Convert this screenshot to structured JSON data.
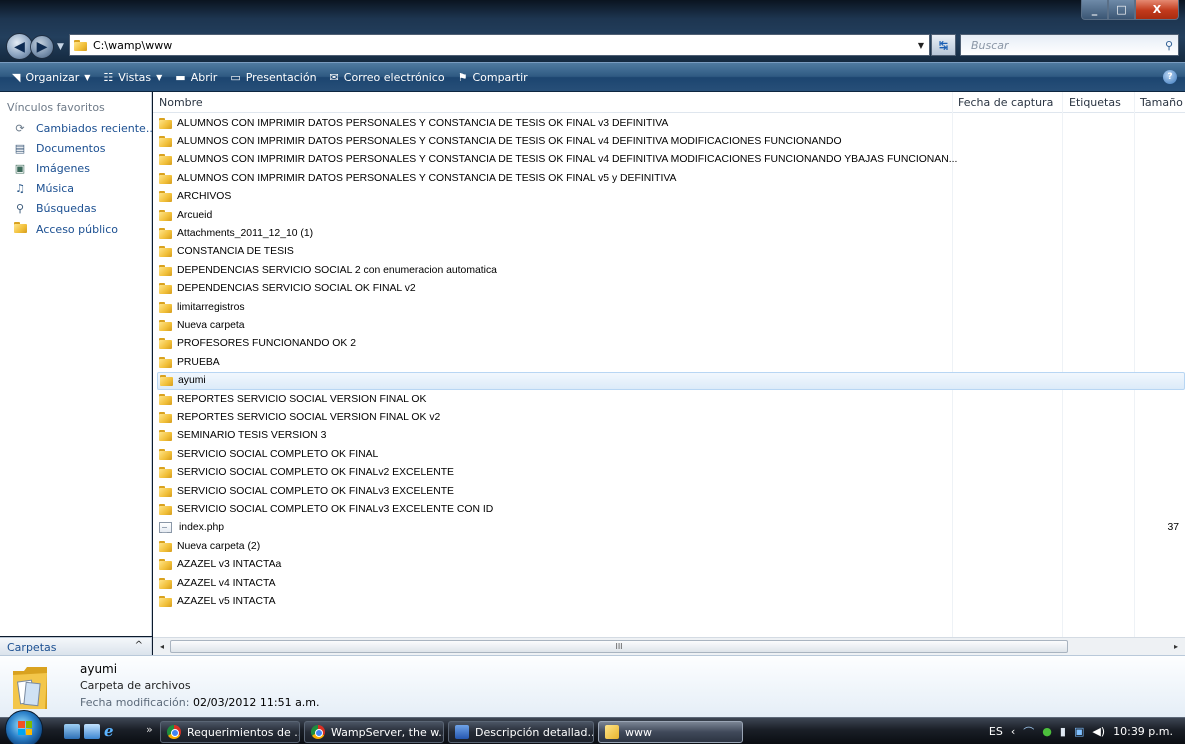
{
  "window": {
    "controls": {
      "minimize": "_",
      "maximize": "□",
      "close": "X"
    }
  },
  "address": {
    "path": "C:\\wamp\\www",
    "search_placeholder": "Buscar"
  },
  "commandbar": {
    "items": [
      {
        "label": "Organizar",
        "icon": "organize-icon",
        "dropdown": true
      },
      {
        "label": "Vistas",
        "icon": "views-icon",
        "dropdown": true
      },
      {
        "label": "Abrir",
        "icon": "open-icon",
        "dropdown": false
      },
      {
        "label": "Presentación",
        "icon": "slideshow-icon",
        "dropdown": false
      },
      {
        "label": "Correo electrónico",
        "icon": "email-icon",
        "dropdown": false
      },
      {
        "label": "Compartir",
        "icon": "share-icon",
        "dropdown": false
      }
    ],
    "help": "?"
  },
  "navpane": {
    "title": "Vínculos favoritos",
    "items": [
      {
        "label": "Cambiados reciente...",
        "icon": "recent-icon"
      },
      {
        "label": "Documentos",
        "icon": "documents-icon"
      },
      {
        "label": "Imágenes",
        "icon": "pictures-icon"
      },
      {
        "label": "Música",
        "icon": "music-icon"
      },
      {
        "label": "Búsquedas",
        "icon": "searches-icon"
      },
      {
        "label": "Acceso público",
        "icon": "public-folder-icon"
      }
    ],
    "folders_label": "Carpetas",
    "folders_chevron": "^"
  },
  "columns": {
    "name": "Nombre",
    "date": "Fecha de captura",
    "tags": "Etiquetas",
    "size": "Tamaño"
  },
  "files": [
    {
      "name": "ALUMNOS CON IMPRIMIR DATOS PERSONALES Y CONSTANCIA DE TESIS OK FINAL v3 DEFINITIVA",
      "type": "folder"
    },
    {
      "name": "ALUMNOS CON IMPRIMIR DATOS PERSONALES Y CONSTANCIA DE TESIS OK FINAL v4 DEFINITIVA MODIFICACIONES FUNCIONANDO",
      "type": "folder"
    },
    {
      "name": "ALUMNOS CON IMPRIMIR DATOS PERSONALES Y CONSTANCIA DE TESIS OK FINAL v4 DEFINITIVA MODIFICACIONES FUNCIONANDO YBAJAS FUNCIONAN...",
      "type": "folder"
    },
    {
      "name": "ALUMNOS CON IMPRIMIR DATOS PERSONALES Y CONSTANCIA DE TESIS OK FINAL v5 y DEFINITIVA",
      "type": "folder"
    },
    {
      "name": "ARCHIVOS",
      "type": "folder"
    },
    {
      "name": "Arcueid",
      "type": "folder"
    },
    {
      "name": "Attachments_2011_12_10 (1)",
      "type": "folder"
    },
    {
      "name": "CONSTANCIA DE TESIS",
      "type": "folder"
    },
    {
      "name": "DEPENDENCIAS SERVICIO SOCIAL 2 con enumeracion automatica",
      "type": "folder"
    },
    {
      "name": "DEPENDENCIAS SERVICIO SOCIAL OK FINAL v2",
      "type": "folder"
    },
    {
      "name": "limitarregistros",
      "type": "folder"
    },
    {
      "name": "Nueva carpeta",
      "type": "folder"
    },
    {
      "name": "PROFESORES FUNCIONANDO OK 2",
      "type": "folder"
    },
    {
      "name": "PRUEBA",
      "type": "folder"
    },
    {
      "name": "ayumi",
      "type": "folder",
      "selected": true
    },
    {
      "name": "REPORTES SERVICIO SOCIAL VERSION FINAL OK",
      "type": "folder"
    },
    {
      "name": "REPORTES SERVICIO SOCIAL VERSION FINAL OK v2",
      "type": "folder"
    },
    {
      "name": "SEMINARIO TESIS VERSION 3",
      "type": "folder"
    },
    {
      "name": "SERVICIO SOCIAL COMPLETO OK FINAL",
      "type": "folder"
    },
    {
      "name": "SERVICIO SOCIAL COMPLETO OK FINALv2 EXCELENTE",
      "type": "folder"
    },
    {
      "name": "SERVICIO SOCIAL COMPLETO OK FINALv3 EXCELENTE",
      "type": "folder"
    },
    {
      "name": "SERVICIO SOCIAL COMPLETO OK FINALv3 EXCELENTE CON ID",
      "type": "folder"
    },
    {
      "name": "index.php",
      "type": "file",
      "size": "37"
    },
    {
      "name": "Nueva carpeta (2)",
      "type": "folder"
    },
    {
      "name": "AZAZEL v3 INTACTAa",
      "type": "folder"
    },
    {
      "name": "AZAZEL v4 INTACTA",
      "type": "folder"
    },
    {
      "name": "AZAZEL v5 INTACTA",
      "type": "folder"
    }
  ],
  "scrollbar": {
    "left": "◂",
    "right": "▸",
    "grip": "III"
  },
  "details": {
    "name": "ayumi",
    "type": "Carpeta de archivos",
    "date_label": "Fecha modificación:",
    "date_value": "02/03/2012 11:51 a.m."
  },
  "taskbar": {
    "more": "»",
    "buttons": [
      {
        "label": "Requerimientos de ...",
        "icon": "chrome-icon"
      },
      {
        "label": "WampServer, the w...",
        "icon": "chrome-icon"
      },
      {
        "label": "Descripción detallad...",
        "icon": "word-icon"
      },
      {
        "label": "www",
        "icon": "folder-icon",
        "active": true
      }
    ],
    "tray": {
      "language": "ES",
      "clock": "10:39 p.m."
    }
  }
}
